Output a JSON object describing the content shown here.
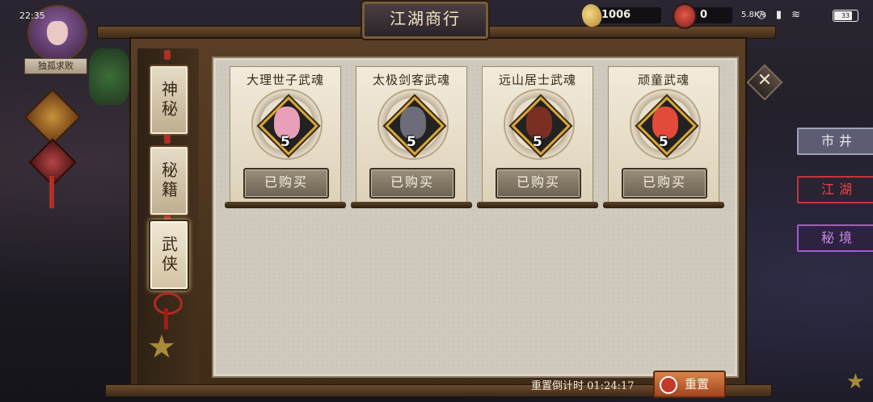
{
  "status": {
    "time": "22:35",
    "net": "5.8K/s",
    "icons": "◷ ▮ ≋",
    "battery": "33"
  },
  "header": {
    "title": "江湖商行"
  },
  "currency": {
    "gold": "1006",
    "gems": "0"
  },
  "player": {
    "title": "独孤求败"
  },
  "tabs": [
    {
      "label": "神秘"
    },
    {
      "label": "秘籍"
    },
    {
      "label": "武侠"
    }
  ],
  "items": [
    {
      "name": "大理世子武魂",
      "level": "5",
      "button": "已购买",
      "portrait_color": "#e7a0b8"
    },
    {
      "name": "太极剑客武魂",
      "level": "5",
      "button": "已购买",
      "portrait_color": "#6d6d7a"
    },
    {
      "name": "远山居士武魂",
      "level": "5",
      "button": "已购买",
      "portrait_color": "#7a2f22"
    },
    {
      "name": "顽童武魂",
      "level": "5",
      "button": "已购买",
      "portrait_color": "#e24a3a"
    }
  ],
  "side_tabs": [
    {
      "label": "市井"
    },
    {
      "label": "江湖"
    },
    {
      "label": "秘境"
    }
  ],
  "footer": {
    "reset_timer": "重置倒计时 01:24:17",
    "reset_button": "重置"
  },
  "colors": {
    "accent": "#d8a73a",
    "panel": "#cfcabd",
    "button": "#7d7261"
  }
}
